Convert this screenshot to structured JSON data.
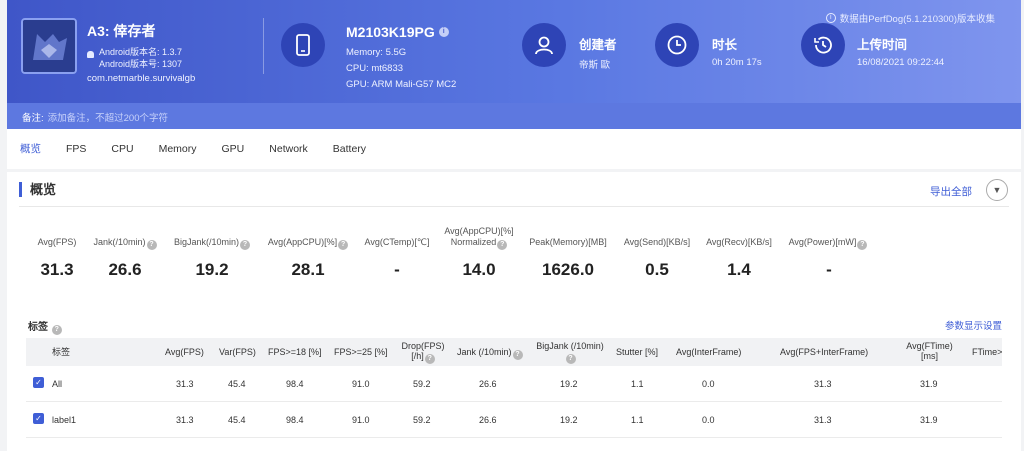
{
  "header": {
    "notice": "数据由PerfDog(5.1.210300)版本收集",
    "app": {
      "name": "A3: 倖存者",
      "android_version_name": "Android版本名: 1.3.7",
      "android_version_code": "Android版本号: 1307",
      "package": "com.netmarble.survivalgb"
    },
    "device": {
      "model": "M2103K19PG",
      "memory": "Memory: 5.5G",
      "cpu": "CPU: mt6833",
      "gpu": "GPU: ARM Mali-G57 MC2"
    },
    "creator": {
      "label": "创建者",
      "value": "帝斯 歐"
    },
    "duration": {
      "label": "时长",
      "value": "0h 20m 17s"
    },
    "upload_time": {
      "label": "上传时间",
      "value": "16/08/2021 09:22:44"
    }
  },
  "note": {
    "label": "备注:",
    "placeholder": "添加备注，不超过200个字符"
  },
  "tabs": [
    "概览",
    "FPS",
    "CPU",
    "Memory",
    "GPU",
    "Network",
    "Battery"
  ],
  "overview": {
    "title": "概览",
    "export_label": "导出全部",
    "metrics": [
      {
        "label": "Avg(FPS)",
        "value": "31.3"
      },
      {
        "label": "Jank(/10min)",
        "value": "26.6"
      },
      {
        "label": "BigJank(/10min)",
        "value": "19.2"
      },
      {
        "label": "Avg(AppCPU)[%]",
        "value": "28.1"
      },
      {
        "label": "Avg(CTemp)[℃]",
        "value": "-"
      },
      {
        "label": "Avg(AppCPU)[%]",
        "label2": "Normalized",
        "value": "14.0"
      },
      {
        "label": "Peak(Memory)[MB]",
        "value": "1626.0"
      },
      {
        "label": "Avg(Send)[KB/s]",
        "value": "0.5"
      },
      {
        "label": "Avg(Recv)[KB/s]",
        "value": "1.4"
      },
      {
        "label": "Avg(Power)[mW]",
        "value": "-"
      }
    ]
  },
  "tags": {
    "title": "标签",
    "settings_label": "参数显示设置",
    "columns": [
      "标签",
      "Avg(FPS)",
      "Var(FPS)",
      "FPS>=18 [%]",
      "FPS>=25 [%]",
      "Drop(FPS)",
      "[/h]",
      "Jank (/10min)",
      "BigJank (/10min)",
      "Stutter [%]",
      "Avg(InterFrame)",
      "Avg(FPS+InterFrame)",
      "Avg(FTime)",
      "[ms]",
      "FTime>"
    ],
    "rows": [
      {
        "name": "All",
        "values": [
          "31.3",
          "45.4",
          "98.4",
          "91.0",
          "59.2",
          "26.6",
          "19.2",
          "1.1",
          "0.0",
          "31.3",
          "31.9"
        ]
      },
      {
        "name": "label1",
        "values": [
          "31.3",
          "45.4",
          "98.4",
          "91.0",
          "59.2",
          "26.6",
          "19.2",
          "1.1",
          "0.0",
          "31.3",
          "31.9"
        ]
      }
    ]
  }
}
